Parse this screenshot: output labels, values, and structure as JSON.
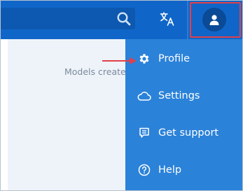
{
  "header": {
    "search_icon": "search-icon",
    "translate_icon": "translate-icon",
    "avatar_icon": "user-avatar-icon"
  },
  "main": {
    "models_text": "Models create"
  },
  "menu": {
    "items": [
      {
        "label": "Profile",
        "icon": "gear-icon"
      },
      {
        "label": "Settings",
        "icon": "cloud-icon"
      },
      {
        "label": "Get support",
        "icon": "chat-icon"
      },
      {
        "label": "Help",
        "icon": "help-circle-icon"
      }
    ]
  },
  "colors": {
    "topbar": "#1066c8",
    "menu": "#2b82d9",
    "highlight": "#e0404a"
  }
}
